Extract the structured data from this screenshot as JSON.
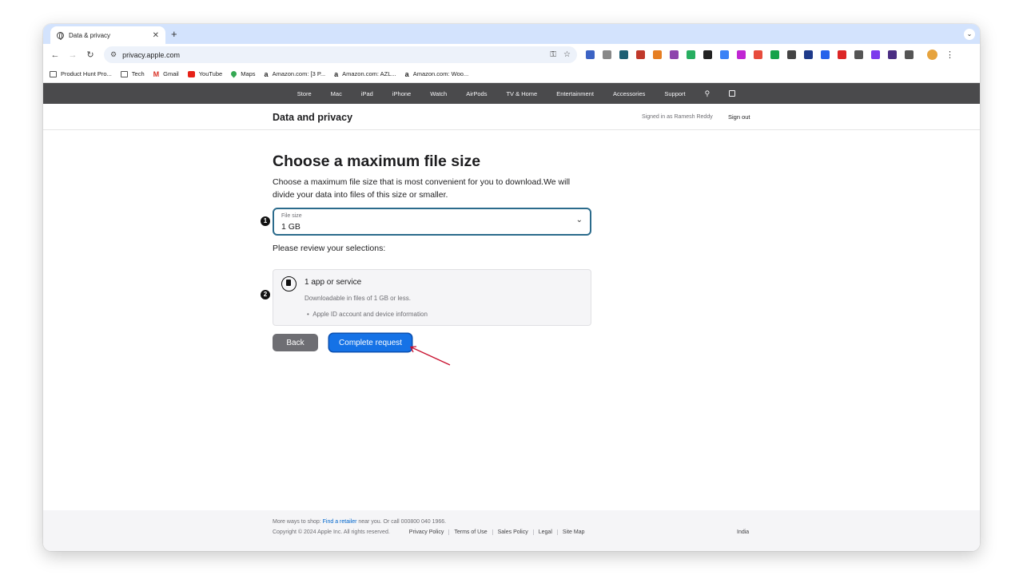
{
  "browser": {
    "tab_title": "Data & privacy",
    "tab_close": "✕",
    "new_tab": "+",
    "url": "privacy.apple.com",
    "bookmarks": [
      {
        "label": "Product Hunt Pro...",
        "icon": "folder-icon"
      },
      {
        "label": "Tech",
        "icon": "folder-icon"
      },
      {
        "label": "Gmail",
        "icon": "gmail-icon"
      },
      {
        "label": "YouTube",
        "icon": "youtube-icon"
      },
      {
        "label": "Maps",
        "icon": "maps-icon"
      },
      {
        "label": "Amazon.com: [3 P...",
        "icon": "amazon-icon"
      },
      {
        "label": "Amazon.com: AZL...",
        "icon": "amazon-icon"
      },
      {
        "label": "Amazon.com: Woo...",
        "icon": "amazon-icon"
      }
    ],
    "extension_colors": [
      "#3c63c4",
      "#888888",
      "#1e5f74",
      "#c0392b",
      "#e67e22",
      "#8e44ad",
      "#27ae60",
      "#222222",
      "#3b82f6",
      "#c026d3",
      "#e74c3c",
      "#16a34a",
      "#444444",
      "#1e3a8a",
      "#2563eb",
      "#dc2626",
      "#555555",
      "#7c3aed",
      "#4b2e83",
      "#555555"
    ]
  },
  "apple_nav": {
    "items": [
      "Store",
      "Mac",
      "iPad",
      "iPhone",
      "Watch",
      "AirPods",
      "TV & Home",
      "Entertainment",
      "Accessories",
      "Support"
    ]
  },
  "subheader": {
    "title": "Data and privacy",
    "signed_in": "Signed in as Ramesh Reddy",
    "sign_out": "Sign out"
  },
  "main": {
    "heading": "Choose a maximum file size",
    "description": "Choose a maximum file size that is most convenient for you to download.We will divide your data into files of this size or smaller.",
    "marker_1": "1",
    "marker_2": "2",
    "file_size_label": "File size",
    "file_size_value": "1 GB",
    "review_label": "Please review your selections:",
    "card_title": "1 app or service",
    "card_subtitle": "Downloadable in files of 1 GB or less.",
    "card_bullet": "Apple ID account and device information",
    "back_button": "Back",
    "complete_button": "Complete request"
  },
  "footer": {
    "more_ways_prefix": "More ways to shop: ",
    "find_retailer": "Find a retailer",
    "more_ways_suffix": " near you. Or call 000800 040 1966.",
    "copyright": "Copyright © 2024 Apple Inc. All rights reserved.",
    "links": [
      "Privacy Policy",
      "Terms of Use",
      "Sales Policy",
      "Legal",
      "Site Map"
    ],
    "country": "India"
  },
  "colors": {
    "accent_blue": "#1572e6",
    "select_border": "#2b6b8c",
    "annotation_arrow": "#c8102e",
    "apple_nav_bg": "#4a4a4c"
  }
}
